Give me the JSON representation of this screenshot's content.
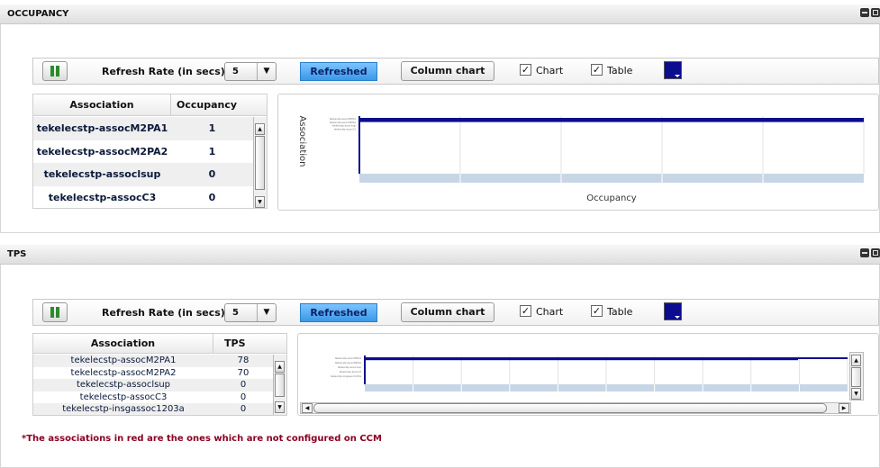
{
  "occupancy": {
    "title": "OCCUPANCY",
    "toolbar": {
      "refresh_label": "Refresh Rate (in secs)",
      "refresh_value": "5",
      "refreshed_label": "Refreshed",
      "column_chart_label": "Column chart",
      "chart_label": "Chart",
      "table_label": "Table",
      "chart_checked": true,
      "table_checked": true,
      "color": "#0c0c8e"
    },
    "columns": [
      "Association",
      "Occupancy"
    ],
    "rows": [
      {
        "association": "tekelecstp-assocM2PA1",
        "value": "1"
      },
      {
        "association": "tekelecstp-assocM2PA2",
        "value": "1"
      },
      {
        "association": "tekelecstp-assoclsup",
        "value": "0"
      },
      {
        "association": "tekelecstp-assocC3",
        "value": "0"
      }
    ],
    "chart_data": {
      "type": "bar",
      "orientation": "horizontal",
      "title": "",
      "xlabel": "Occupancy",
      "ylabel": "Association",
      "categories": [
        "tekelecstp-assocM2PA1",
        "tekelecstp-assocM2PA2",
        "tekelecstp-assoclsup",
        "tekelecstp-assocC3"
      ],
      "values": [
        1,
        1,
        0,
        0
      ],
      "color": "#0c0c8e",
      "grid": true
    }
  },
  "tps": {
    "title": "TPS",
    "toolbar": {
      "refresh_label": "Refresh Rate (in secs)",
      "refresh_value": "5",
      "refreshed_label": "Refreshed",
      "column_chart_label": "Column chart",
      "chart_label": "Chart",
      "table_label": "Table",
      "chart_checked": true,
      "table_checked": true,
      "color": "#0c0c8e"
    },
    "columns": [
      "Association",
      "TPS"
    ],
    "rows": [
      {
        "association": "tekelecstp-assocM2PA1",
        "value": "78"
      },
      {
        "association": "tekelecstp-assocM2PA2",
        "value": "70"
      },
      {
        "association": "tekelecstp-assoclsup",
        "value": "0"
      },
      {
        "association": "tekelecstp-assocC3",
        "value": "0"
      },
      {
        "association": "tekelecstp-insgassoc1203a",
        "value": "0"
      }
    ],
    "chart_data": {
      "type": "bar",
      "orientation": "horizontal",
      "title": "",
      "xlabel": "",
      "ylabel": "",
      "categories": [
        "tekelecstp-assocM2PA1",
        "tekelecstp-assocM2PA2",
        "tekelecstp-assoclsup",
        "tekelecstp-assocC3",
        "tekelecstp-insgassoc1203a"
      ],
      "values": [
        78,
        70,
        0,
        0,
        0
      ],
      "color": "#0c0c8e",
      "grid": true
    }
  },
  "footnote": "*The associations in red are the ones which are not configured on CCM"
}
